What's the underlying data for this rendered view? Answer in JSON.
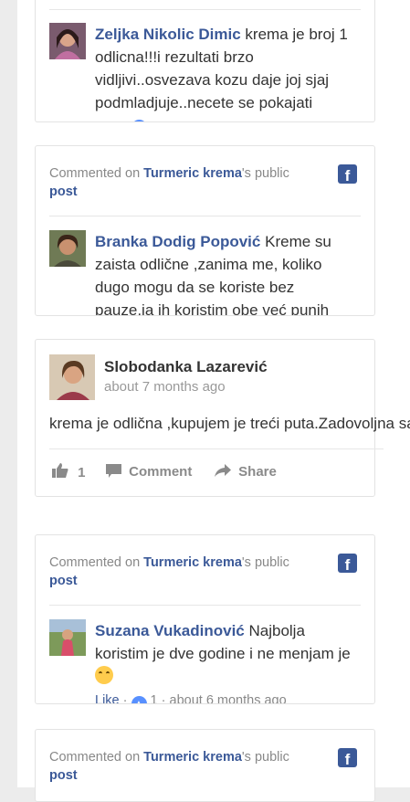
{
  "feed": {
    "comment_prefix": "Commented on",
    "post_link": "Turmeric krema",
    "public_suffix": "'s public",
    "post_word": "post",
    "top_comment": {
      "author": "Zeljka Nikolic Dimic",
      "text": "krema je broj 1 odlicna!!!i rezultati brzo vidljivi..osvezava kozu daje joj sjaj podmladjuje..necete se pokajati"
    },
    "card1": {
      "author": "Branka Dodig Popović",
      "text": "Kreme su zaista odlične ,zanima me, koliko dugo mogu da se koriste bez pauze,ja ih koristim obe već punih"
    },
    "card2": {
      "author": "Slobodanka Lazarević",
      "time": "about 7 months ago",
      "text": "krema je odlična ,kupujem je treći puta.Zadovoljna sam",
      "likes": "1",
      "comment_label": "Comment",
      "share_label": "Share"
    },
    "card3": {
      "author": "Suzana Vukadinović",
      "text": "Najbolja koristim je dve godine i ne menjam je",
      "like_label": "Like",
      "like_count": "1",
      "time": "about 6 months ago"
    }
  },
  "colors": {
    "brand": "#3b5998",
    "like_blue": "#5890ff"
  }
}
